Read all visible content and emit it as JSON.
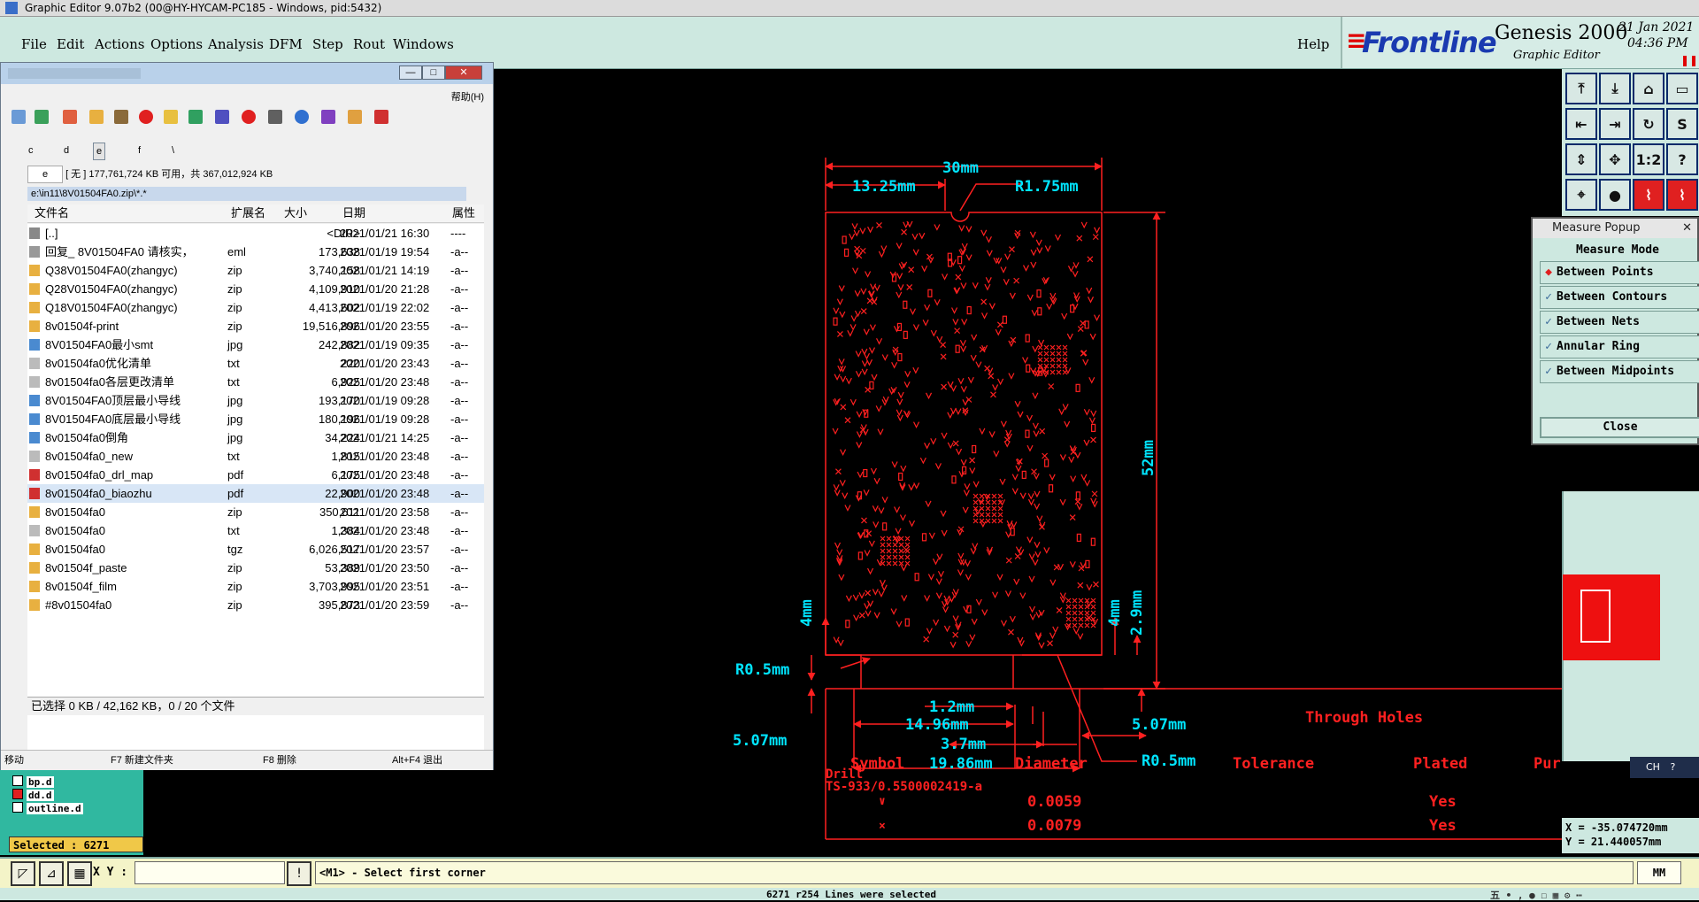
{
  "window": {
    "title": "Graphic Editor 9.07b2 (00@HY-HYCAM-PC185 - Windows, pid:5432)"
  },
  "menubar": {
    "items": [
      "File",
      "Edit",
      "Actions",
      "Options",
      "Analysis",
      "DFM",
      "Step",
      "Rout",
      "Windows"
    ],
    "help": "Help"
  },
  "logo": {
    "brand": "Frontline",
    "product": "Genesis 2000",
    "subtitle": "Graphic Editor",
    "date": "21 Jan 2021",
    "time": "04:36 PM"
  },
  "file_manager": {
    "help_menu": "帮助(H)",
    "drives": [
      "c",
      "d",
      "e",
      "f",
      "\\"
    ],
    "active_drive": "e",
    "disk_combo": "e",
    "disk_info": "[ 无 ]  177,761,724 KB 可用，共 367,012,924 KB",
    "path": "e:\\in11\\8V01504FA0.zip\\*.*",
    "columns": {
      "name": "文件名",
      "ext": "扩展名",
      "size": "大小",
      "date": "日期",
      "attr": "属性"
    },
    "files": [
      {
        "name": "[..]",
        "ext": "",
        "size": "<DIR>",
        "date": "2021/01/21 16:30",
        "attr": "----",
        "icon": "up-icon"
      },
      {
        "name": "回复_ 8V01504FA0 请核实，",
        "ext": "eml",
        "size": "173,638",
        "date": "2021/01/19 19:54",
        "attr": "-a--",
        "icon": "mail-icon"
      },
      {
        "name": "Q38V01504FA0(zhangyc)",
        "ext": "zip",
        "size": "3,740,158",
        "date": "2021/01/21 14:19",
        "attr": "-a--",
        "icon": "zip-icon"
      },
      {
        "name": "Q28V01504FA0(zhangyc)",
        "ext": "zip",
        "size": "4,109,910",
        "date": "2021/01/20 21:28",
        "attr": "-a--",
        "icon": "zip-icon"
      },
      {
        "name": "Q18V01504FA0(zhangyc)",
        "ext": "zip",
        "size": "4,413,602",
        "date": "2021/01/19 22:02",
        "attr": "-a--",
        "icon": "zip-icon"
      },
      {
        "name": "8v01504f-print",
        "ext": "zip",
        "size": "19,516,896",
        "date": "2021/01/20 23:55",
        "attr": "-a--",
        "icon": "zip-icon"
      },
      {
        "name": "8V01504FA0最小smt",
        "ext": "jpg",
        "size": "242,882",
        "date": "2021/01/19 09:35",
        "attr": "-a--",
        "icon": "image-icon"
      },
      {
        "name": "8v01504fa0优化清单",
        "ext": "txt",
        "size": "220",
        "date": "2021/01/20 23:43",
        "attr": "-a--",
        "icon": "text-file-icon"
      },
      {
        "name": "8v01504fa0各层更改清单",
        "ext": "txt",
        "size": "6,925",
        "date": "2021/01/20 23:48",
        "attr": "-a--",
        "icon": "text-file-icon"
      },
      {
        "name": "8V01504FA0顶层最小导线",
        "ext": "jpg",
        "size": "193,170",
        "date": "2021/01/19 09:28",
        "attr": "-a--",
        "icon": "image-icon"
      },
      {
        "name": "8V01504FA0底层最小导线",
        "ext": "jpg",
        "size": "180,196",
        "date": "2021/01/19 09:28",
        "attr": "-a--",
        "icon": "image-icon"
      },
      {
        "name": "8v01504fa0倒角",
        "ext": "jpg",
        "size": "34,224",
        "date": "2021/01/21 14:25",
        "attr": "-a--",
        "icon": "image-icon"
      },
      {
        "name": "8v01504fa0_new",
        "ext": "txt",
        "size": "1,815",
        "date": "2021/01/20 23:48",
        "attr": "-a--",
        "icon": "text-file-icon"
      },
      {
        "name": "8v01504fa0_drl_map",
        "ext": "pdf",
        "size": "6,175",
        "date": "2021/01/20 23:48",
        "attr": "-a--",
        "icon": "pdf-icon"
      },
      {
        "name": "8v01504fa0_biaozhu",
        "ext": "pdf",
        "size": "22,900",
        "date": "2021/01/20 23:48",
        "attr": "-a--",
        "icon": "pdf-icon",
        "selected": true
      },
      {
        "name": "8v01504fa0",
        "ext": "zip",
        "size": "350,611",
        "date": "2021/01/20 23:58",
        "attr": "-a--",
        "icon": "zip-icon"
      },
      {
        "name": "8v01504fa0",
        "ext": "txt",
        "size": "1,384",
        "date": "2021/01/20 23:48",
        "attr": "-a--",
        "icon": "text-file-icon"
      },
      {
        "name": "8v01504fa0",
        "ext": "tgz",
        "size": "6,026,517",
        "date": "2021/01/20 23:57",
        "attr": "-a--",
        "icon": "zip-icon"
      },
      {
        "name": "8v01504f_paste",
        "ext": "zip",
        "size": "53,389",
        "date": "2021/01/20 23:50",
        "attr": "-a--",
        "icon": "zip-icon"
      },
      {
        "name": "8v01504f_film",
        "ext": "zip",
        "size": "3,703,995",
        "date": "2021/01/20 23:51",
        "attr": "-a--",
        "icon": "zip-icon"
      },
      {
        "name": "#8v01504fa0",
        "ext": "zip",
        "size": "395,873",
        "date": "2021/01/20 23:59",
        "attr": "-a--",
        "icon": "zip-icon"
      }
    ],
    "status": "已选择 0 KB / 42,162 KB，0 / 20 个文件",
    "fkeys": [
      "移动",
      "F7 新建文件夹",
      "F8 删除",
      "Alt+F4 退出"
    ]
  },
  "drawing": {
    "dims": [
      "30mm",
      "13.25mm",
      "R1.75mm",
      "52mm",
      "4mm",
      "4mm",
      "2.9mm",
      "R0.5mm",
      "1.2mm",
      "14.96mm",
      "3.7mm",
      "19.86mm",
      "5.07mm",
      "5.07mm",
      "R0.5mm"
    ],
    "table": {
      "title": "Through Holes",
      "headers": [
        "Symbol",
        "Diameter",
        "Tolerance",
        "Plated",
        "Pur"
      ],
      "drill_label": "Drill",
      "drill_file": "TS-933/0.5500002419-a",
      "rows": [
        {
          "diameter": "0.0059",
          "plated": "Yes"
        },
        {
          "diameter": "0.0079",
          "plated": "Yes"
        }
      ]
    }
  },
  "measure_popup": {
    "title": "Measure Popup",
    "mode_label": "Measure Mode",
    "options": [
      "Between Points",
      "Between Contours",
      "Between Nets",
      "Annular Ring",
      "Between Midpoints"
    ],
    "selected": "Between Points",
    "close": "Close"
  },
  "overview": {
    "ch_badge": "CH",
    "x": "X = -35.074720mm",
    "y": "Y = 21.440057mm"
  },
  "layers": {
    "items": [
      "bp.d",
      "dd.d",
      "outline.d"
    ],
    "selected": "Selected : 6271"
  },
  "command": {
    "xy_label": "X Y :",
    "prompt": "<M1> - Select first corner",
    "units": "MM"
  },
  "status": {
    "message": "6271 r254 Lines were selected",
    "ime": "五 • , ● ☐ ▦ ⚙ ⋯"
  },
  "colors": {
    "drawing": "#ff2020",
    "dimension": "#00e5ff",
    "accent": "#cde8e0"
  }
}
